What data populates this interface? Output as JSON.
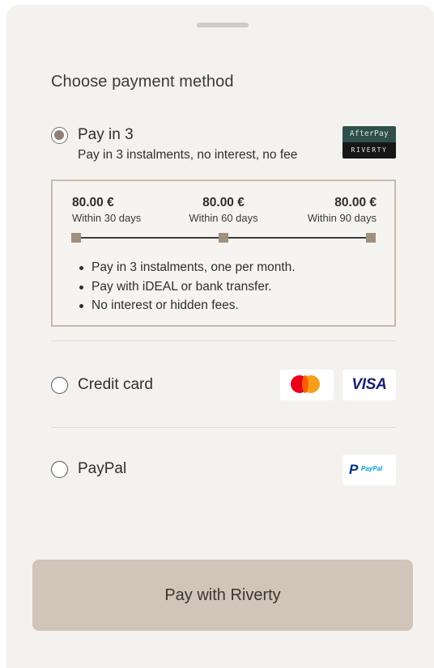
{
  "sheet": {
    "title": "Choose payment method"
  },
  "options": {
    "pay_in_3": {
      "label": "Pay in 3",
      "subtitle": "Pay in 3 instalments, no interest, no fee",
      "selected": true,
      "badge_top": "AfterPay",
      "badge_bottom": "RIVERTY"
    },
    "credit_card": {
      "label": "Credit card",
      "selected": false,
      "logos": [
        "mastercard-icon",
        "visa-icon"
      ],
      "visa_text": "VISA"
    },
    "paypal": {
      "label": "PayPal",
      "selected": false,
      "logo_letter": "P",
      "logo_text": "PayPal"
    }
  },
  "plan": {
    "instalments": [
      {
        "amount": "80.00 €",
        "when": "Within 30 days"
      },
      {
        "amount": "80.00 €",
        "when": "Within 60 days"
      },
      {
        "amount": "80.00 €",
        "when": "Within 90 days"
      }
    ],
    "bullets": [
      "Pay in 3 instalments, one per month.",
      "Pay with iDEAL or bank transfer.",
      "No interest or hidden fees."
    ]
  },
  "cta": {
    "label": "Pay with Riverty"
  },
  "colors": {
    "sheet_bg": "#f4f2ef",
    "accent": "#8d7f74",
    "box_border": "#c8b9aa",
    "button_bg": "#d1c4b9"
  }
}
